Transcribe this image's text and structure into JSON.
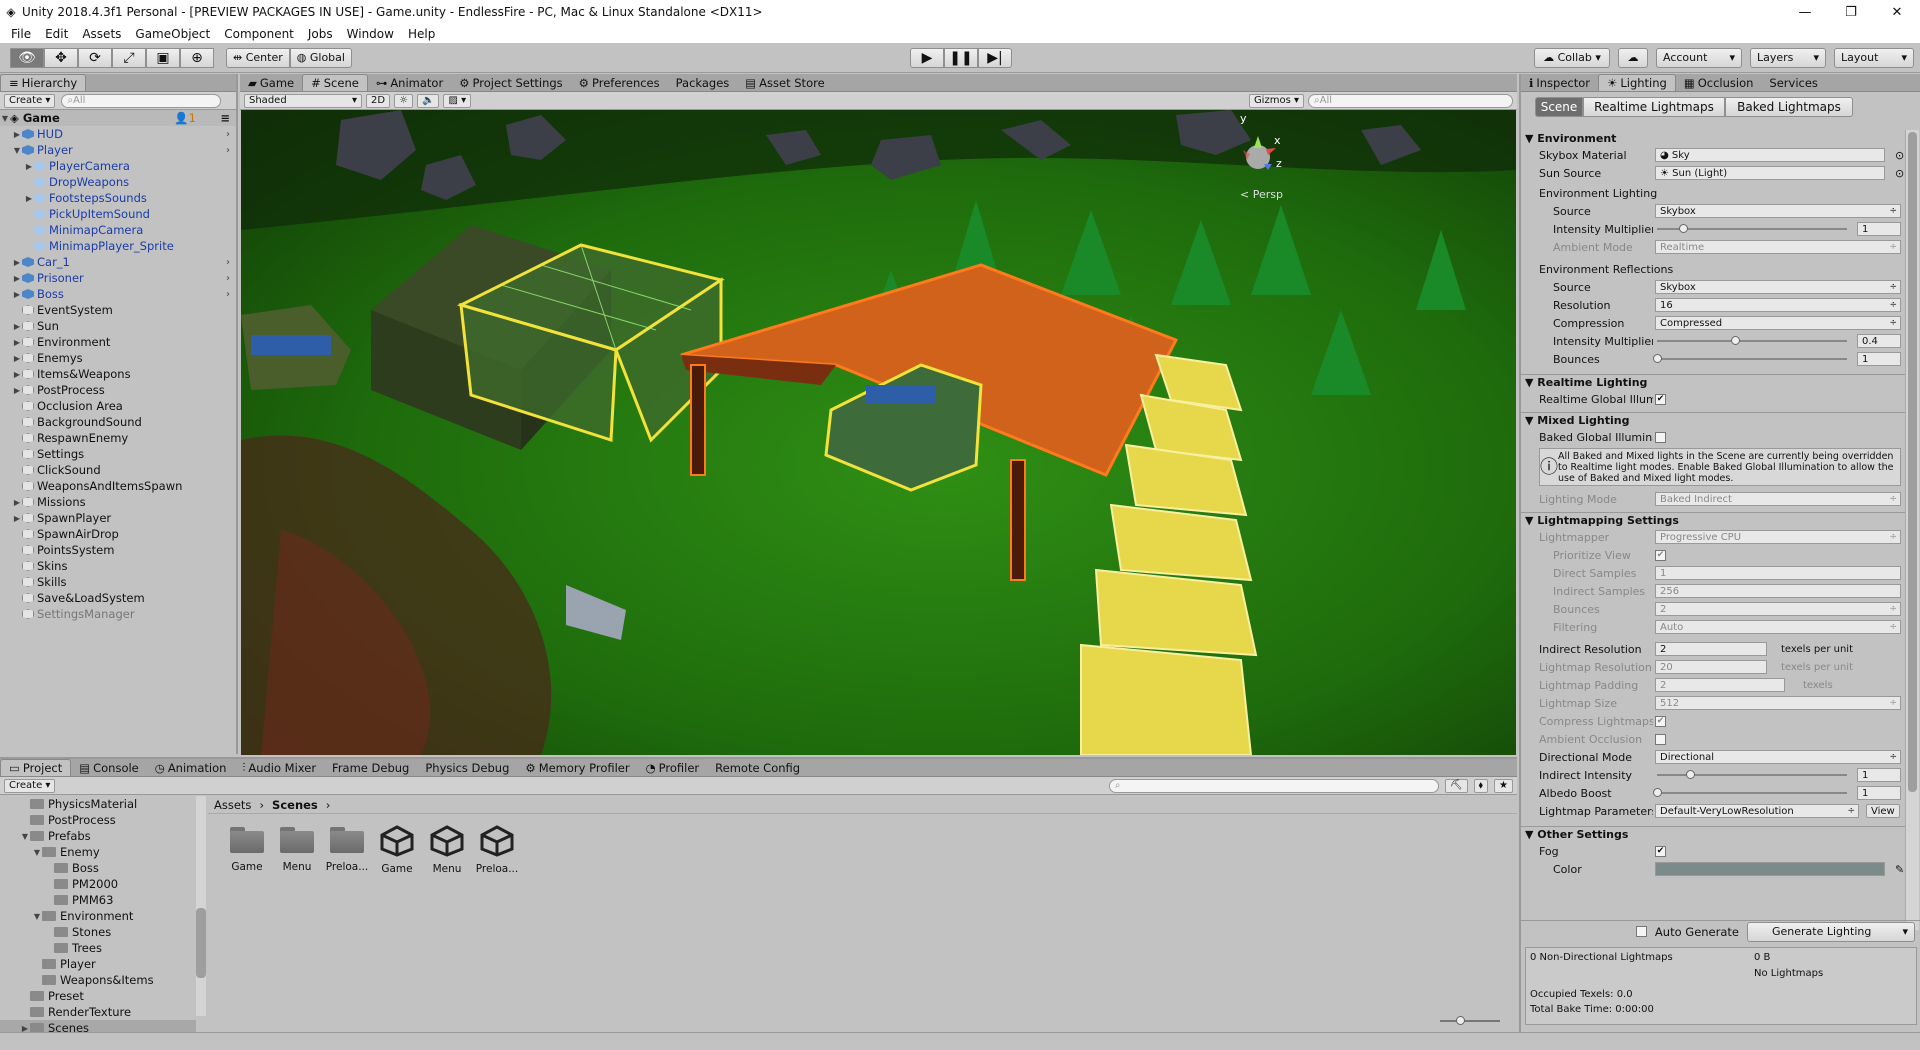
{
  "window": {
    "title": "Unity 2018.4.3f1 Personal - [PREVIEW PACKAGES IN USE] - Game.unity - EndlessFire - PC, Mac & Linux Standalone <DX11>"
  },
  "menu": [
    "File",
    "Edit",
    "Assets",
    "GameObject",
    "Component",
    "Jobs",
    "Window",
    "Help"
  ],
  "toolbar": {
    "center": "Center",
    "global": "Global",
    "collab": "Collab",
    "account": "Account",
    "layers": "Layers",
    "layout": "Layout"
  },
  "hierarchy": {
    "tab": "Hierarchy",
    "create": "Create",
    "search": "All",
    "scene": "Game",
    "badge": "1",
    "items": [
      {
        "label": "HUD",
        "indent": 1,
        "type": "blue",
        "arrow": "▶",
        "chev": true
      },
      {
        "label": "Player",
        "indent": 1,
        "type": "blue",
        "arrow": "▼",
        "chev": true
      },
      {
        "label": "PlayerCamera",
        "indent": 2,
        "type": "lb",
        "arrow": "▶",
        "chev": false
      },
      {
        "label": "DropWeapons",
        "indent": 2,
        "type": "lb",
        "arrow": "",
        "chev": false
      },
      {
        "label": "FootstepsSounds",
        "indent": 2,
        "type": "lb",
        "arrow": "▶",
        "chev": false
      },
      {
        "label": "PickUpItemSound",
        "indent": 2,
        "type": "lb",
        "arrow": "",
        "chev": false
      },
      {
        "label": "MinimapCamera",
        "indent": 2,
        "type": "lb",
        "arrow": "",
        "chev": false
      },
      {
        "label": "MinimapPlayer_Sprite",
        "indent": 2,
        "type": "lb",
        "arrow": "",
        "chev": false
      },
      {
        "label": "Car_1",
        "indent": 1,
        "type": "blue",
        "arrow": "▶",
        "chev": true
      },
      {
        "label": "Prisoner",
        "indent": 1,
        "type": "blue",
        "arrow": "▶",
        "chev": true
      },
      {
        "label": "Boss",
        "indent": 1,
        "type": "blue",
        "arrow": "▶",
        "chev": true
      },
      {
        "label": "EventSystem",
        "indent": 1,
        "type": "grey",
        "arrow": "",
        "chev": false
      },
      {
        "label": "Sun",
        "indent": 1,
        "type": "grey",
        "arrow": "▶",
        "chev": false
      },
      {
        "label": "Environment",
        "indent": 1,
        "type": "grey",
        "arrow": "▶",
        "chev": false
      },
      {
        "label": "Enemys",
        "indent": 1,
        "type": "grey",
        "arrow": "▶",
        "chev": false
      },
      {
        "label": "Items&Weapons",
        "indent": 1,
        "type": "grey",
        "arrow": "▶",
        "chev": false
      },
      {
        "label": "PostProcess",
        "indent": 1,
        "type": "grey",
        "arrow": "▶",
        "chev": false
      },
      {
        "label": "Occlusion Area",
        "indent": 1,
        "type": "grey",
        "arrow": "",
        "chev": false
      },
      {
        "label": "BackgroundSound",
        "indent": 1,
        "type": "grey",
        "arrow": "",
        "chev": false
      },
      {
        "label": "RespawnEnemy",
        "indent": 1,
        "type": "grey",
        "arrow": "",
        "chev": false
      },
      {
        "label": "Settings",
        "indent": 1,
        "type": "grey",
        "arrow": "",
        "chev": false
      },
      {
        "label": "ClickSound",
        "indent": 1,
        "type": "grey",
        "arrow": "",
        "chev": false
      },
      {
        "label": "WeaponsAndItemsSpawn",
        "indent": 1,
        "type": "grey",
        "arrow": "",
        "chev": false
      },
      {
        "label": "Missions",
        "indent": 1,
        "type": "grey",
        "arrow": "▶",
        "chev": false
      },
      {
        "label": "SpawnPlayer",
        "indent": 1,
        "type": "grey",
        "arrow": "▶",
        "chev": false
      },
      {
        "label": "SpawnAirDrop",
        "indent": 1,
        "type": "grey",
        "arrow": "",
        "chev": false
      },
      {
        "label": "PointsSystem",
        "indent": 1,
        "type": "grey",
        "arrow": "",
        "chev": false
      },
      {
        "label": "Skins",
        "indent": 1,
        "type": "grey",
        "arrow": "",
        "chev": false
      },
      {
        "label": "Skills",
        "indent": 1,
        "type": "grey",
        "arrow": "",
        "chev": false
      },
      {
        "label": "Save&LoadSystem",
        "indent": 1,
        "type": "grey",
        "arrow": "",
        "chev": false
      },
      {
        "label": "SettingsManager",
        "indent": 1,
        "type": "grey",
        "arrow": "",
        "chev": false,
        "dim": true
      }
    ]
  },
  "scene": {
    "tabs": [
      "Game",
      "Scene",
      "Animator",
      "Project Settings",
      "Preferences",
      "Packages",
      "Asset Store"
    ],
    "shaded": "Shaded",
    "mode2d": "2D",
    "gizmos": "Gizmos",
    "search": "All",
    "persp": "< Persp",
    "axis": {
      "y": "y",
      "x": "x",
      "z": "z"
    }
  },
  "inspector": {
    "tabs": [
      "Inspector",
      "Lighting",
      "Occlusion",
      "Services"
    ],
    "subtabs": [
      "Scene",
      "Realtime Lightmaps",
      "Baked Lightmaps"
    ],
    "env": {
      "header": "Environment",
      "skybox_label": "Skybox Material",
      "skybox": "Sky",
      "sun_label": "Sun Source",
      "sun": "Sun (Light)",
      "envlight": "Environment Lighting",
      "source_label": "Source",
      "source": "Skybox",
      "intensity_label": "Intensity Multiplier",
      "intensity": "1",
      "ambient_label": "Ambient Mode",
      "ambient": "Realtime",
      "envrefl": "Environment Reflections",
      "rsource": "Skybox",
      "res_label": "Resolution",
      "res": "16",
      "comp_label": "Compression",
      "comp": "Compressed",
      "rintensity": "0.4",
      "bounces_label": "Bounces",
      "bounces": "1"
    },
    "realtime": {
      "header": "Realtime Lighting",
      "gi_label": "Realtime Global Illumination"
    },
    "mixed": {
      "header": "Mixed Lighting",
      "baked_label": "Baked Global Illumination",
      "note": "All Baked and Mixed lights in the Scene are currently being overridden to Realtime light modes. Enable Baked Global Illumination to allow the use of Baked and Mixed light modes.",
      "mode_label": "Lighting Mode",
      "mode": "Baked Indirect"
    },
    "lm": {
      "header": "Lightmapping Settings",
      "lightmapper_label": "Lightmapper",
      "lightmapper": "Progressive CPU",
      "prioritize": "Prioritize View",
      "direct_label": "Direct Samples",
      "direct": "1",
      "indirect_label": "Indirect Samples",
      "indirect": "256",
      "bounces_label": "Bounces",
      "bounces": "2",
      "filter_label": "Filtering",
      "filter": "Auto",
      "ires_label": "Indirect Resolution",
      "ires": "2",
      "texels": "texels per unit",
      "lres_label": "Lightmap Resolution",
      "lres": "20",
      "pad_label": "Lightmap Padding",
      "pad": "2",
      "texels2": "texels",
      "size_label": "Lightmap Size",
      "size": "512",
      "compress_label": "Compress Lightmaps",
      "ao_label": "Ambient Occlusion",
      "dir_label": "Directional Mode",
      "dir": "Directional",
      "iint_label": "Indirect Intensity",
      "iint": "1",
      "albedo_label": "Albedo Boost",
      "albedo": "1",
      "param_label": "Lightmap Parameters",
      "param": "Default-VeryLowResolution",
      "view": "View"
    },
    "other": {
      "header": "Other Settings",
      "fog_label": "Fog",
      "color_label": "Color"
    },
    "auto_generate": "Auto Generate",
    "generate": "Generate Lighting",
    "stats": {
      "nondir": "0 Non-Directional Lightmaps",
      "size": "0 B",
      "nolm": "No Lightmaps",
      "occupied": "Occupied Texels: 0.0",
      "bake": "Total Bake Time: 0:00:00"
    }
  },
  "project": {
    "tabs": [
      "Project",
      "Console",
      "Animation",
      "Audio Mixer",
      "Frame Debug",
      "Physics Debug",
      "Memory Profiler",
      "Profiler",
      "Remote Config"
    ],
    "create": "Create",
    "tree": [
      {
        "label": "PhysicsMaterial",
        "indent": 1,
        "arrow": ""
      },
      {
        "label": "PostProcess",
        "indent": 1,
        "arrow": ""
      },
      {
        "label": "Prefabs",
        "indent": 1,
        "arrow": "▼"
      },
      {
        "label": "Enemy",
        "indent": 2,
        "arrow": "▼"
      },
      {
        "label": "Boss",
        "indent": 3,
        "arrow": ""
      },
      {
        "label": "PM2000",
        "indent": 3,
        "arrow": ""
      },
      {
        "label": "PMM63",
        "indent": 3,
        "arrow": ""
      },
      {
        "label": "Environment",
        "indent": 2,
        "arrow": "▼"
      },
      {
        "label": "Stones",
        "indent": 3,
        "arrow": ""
      },
      {
        "label": "Trees",
        "indent": 3,
        "arrow": ""
      },
      {
        "label": "Player",
        "indent": 2,
        "arrow": ""
      },
      {
        "label": "Weapons&Items",
        "indent": 2,
        "arrow": ""
      },
      {
        "label": "Preset",
        "indent": 1,
        "arrow": ""
      },
      {
        "label": "RenderTexture",
        "indent": 1,
        "arrow": ""
      },
      {
        "label": "Scenes",
        "indent": 1,
        "arrow": "▶"
      }
    ],
    "breadcrumb": [
      "Assets",
      "Scenes"
    ],
    "assets": [
      {
        "label": "Game",
        "kind": "folder"
      },
      {
        "label": "Menu",
        "kind": "folder"
      },
      {
        "label": "Preloa...",
        "kind": "folder"
      },
      {
        "label": "Game",
        "kind": "unity"
      },
      {
        "label": "Menu",
        "kind": "unity"
      },
      {
        "label": "Preloa...",
        "kind": "unity"
      }
    ]
  }
}
